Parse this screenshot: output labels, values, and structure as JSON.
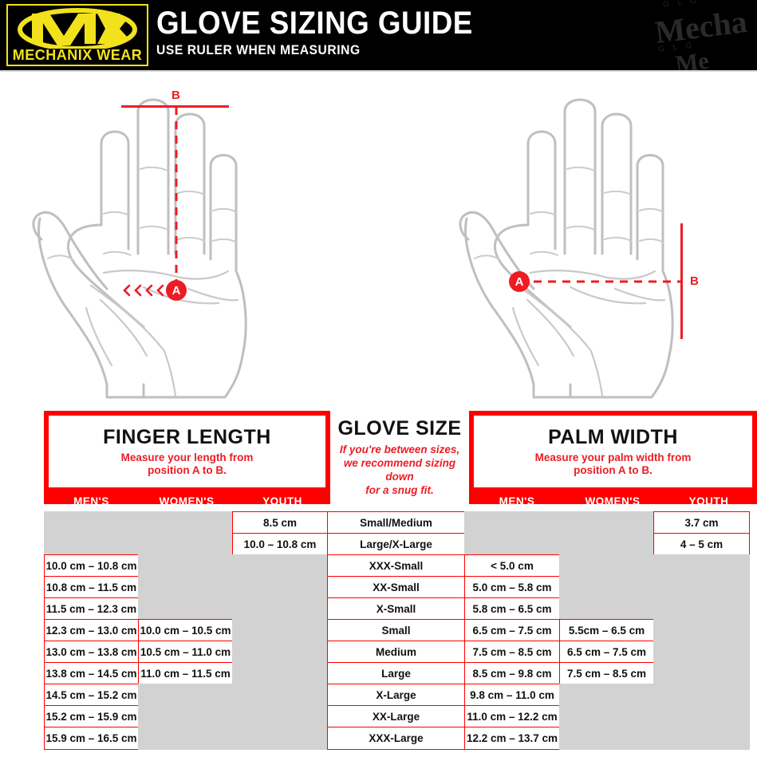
{
  "header": {
    "title": "GLOVE SIZING GUIDE",
    "subtitle": "USE RULER WHEN MEASURING",
    "logo_brand": "MECHANIX",
    "logo_word": "WEAR",
    "logo_alt": "mechanix-wear-logo",
    "watermark_text": "Mecha",
    "watermark_text2": "Me",
    "watermark_text3": "Me",
    "watermark_micro": "G L O",
    "colors": {
      "background": "#000000",
      "logo_yellow": "#F2E21C",
      "title_white": "#FFFFFF"
    }
  },
  "diagrams": {
    "left": {
      "name": "finger-length-diagram",
      "point_a": "A",
      "point_b": "B",
      "description": "Vertical dashed measurement line from base of middle finger (A) to fingertip line (B)"
    },
    "right": {
      "name": "palm-width-diagram",
      "point_a": "A",
      "point_b": "B",
      "description": "Horizontal dashed measurement line across palm from thumb web (A) to outer edge (B)"
    }
  },
  "table": {
    "sections": [
      {
        "id": "finger-length",
        "title": "FINGER LENGTH",
        "subtitle_line1": "Measure your length from",
        "subtitle_line2": "position A to B.",
        "columns": [
          "MEN'S",
          "WOMEN'S",
          "YOUTH"
        ]
      },
      {
        "id": "glove-size",
        "title": "GLOVE SIZE",
        "subtitle_line1": "If you're between sizes,",
        "subtitle_line2": "we recommend sizing down",
        "subtitle_line3": "for a snug fit."
      },
      {
        "id": "palm-width",
        "title": "PALM WIDTH",
        "subtitle_line1": "Measure your palm width from",
        "subtitle_line2": "position A to B.",
        "columns": [
          "MEN'S",
          "WOMEN'S",
          "YOUTH"
        ]
      }
    ],
    "colors": {
      "red": "#FF0000",
      "grey": "#D2D2D2",
      "text": "#111111",
      "accent_red_text": "#ED1C24"
    },
    "rows": [
      {
        "finger_mens": "",
        "finger_womens": "",
        "finger_youth": "8.5 cm",
        "glove_size": "Small/Medium",
        "palm_mens": "",
        "palm_womens": "",
        "palm_youth": "3.7 cm"
      },
      {
        "finger_mens": "",
        "finger_womens": "",
        "finger_youth": "10.0 – 10.8 cm",
        "glove_size": "Large/X-Large",
        "palm_mens": "",
        "palm_womens": "",
        "palm_youth": "4 – 5 cm"
      },
      {
        "finger_mens": "10.0 cm – 10.8 cm",
        "finger_womens": "",
        "finger_youth": "",
        "glove_size": "XXX-Small",
        "palm_mens": "< 5.0 cm",
        "palm_womens": "",
        "palm_youth": ""
      },
      {
        "finger_mens": "10.8 cm – 11.5 cm",
        "finger_womens": "",
        "finger_youth": "",
        "glove_size": "XX-Small",
        "palm_mens": "5.0 cm – 5.8 cm",
        "palm_womens": "",
        "palm_youth": ""
      },
      {
        "finger_mens": "11.5 cm – 12.3 cm",
        "finger_womens": "",
        "finger_youth": "",
        "glove_size": "X-Small",
        "palm_mens": "5.8 cm – 6.5 cm",
        "palm_womens": "",
        "palm_youth": ""
      },
      {
        "finger_mens": "12.3 cm – 13.0 cm",
        "finger_womens": "10.0 cm – 10.5 cm",
        "finger_youth": "",
        "glove_size": "Small",
        "palm_mens": "6.5 cm – 7.5 cm",
        "palm_womens": "5.5cm – 6.5 cm",
        "palm_youth": ""
      },
      {
        "finger_mens": "13.0 cm – 13.8 cm",
        "finger_womens": "10.5 cm – 11.0 cm",
        "finger_youth": "",
        "glove_size": "Medium",
        "palm_mens": "7.5 cm – 8.5 cm",
        "palm_womens": "6.5 cm – 7.5 cm",
        "palm_youth": ""
      },
      {
        "finger_mens": "13.8 cm – 14.5 cm",
        "finger_womens": "11.0 cm – 11.5 cm",
        "finger_youth": "",
        "glove_size": "Large",
        "palm_mens": "8.5 cm – 9.8 cm",
        "palm_womens": "7.5 cm – 8.5 cm",
        "palm_youth": ""
      },
      {
        "finger_mens": "14.5 cm – 15.2 cm",
        "finger_womens": "",
        "finger_youth": "",
        "glove_size": "X-Large",
        "palm_mens": "9.8 cm – 11.0 cm",
        "palm_womens": "",
        "palm_youth": ""
      },
      {
        "finger_mens": "15.2 cm – 15.9 cm",
        "finger_womens": "",
        "finger_youth": "",
        "glove_size": "XX-Large",
        "palm_mens": "11.0 cm – 12.2 cm",
        "palm_womens": "",
        "palm_youth": ""
      },
      {
        "finger_mens": "15.9 cm – 16.5 cm",
        "finger_womens": "",
        "finger_youth": "",
        "glove_size": "XXX-Large",
        "palm_mens": "12.2 cm – 13.7 cm",
        "palm_womens": "",
        "palm_youth": ""
      }
    ]
  }
}
